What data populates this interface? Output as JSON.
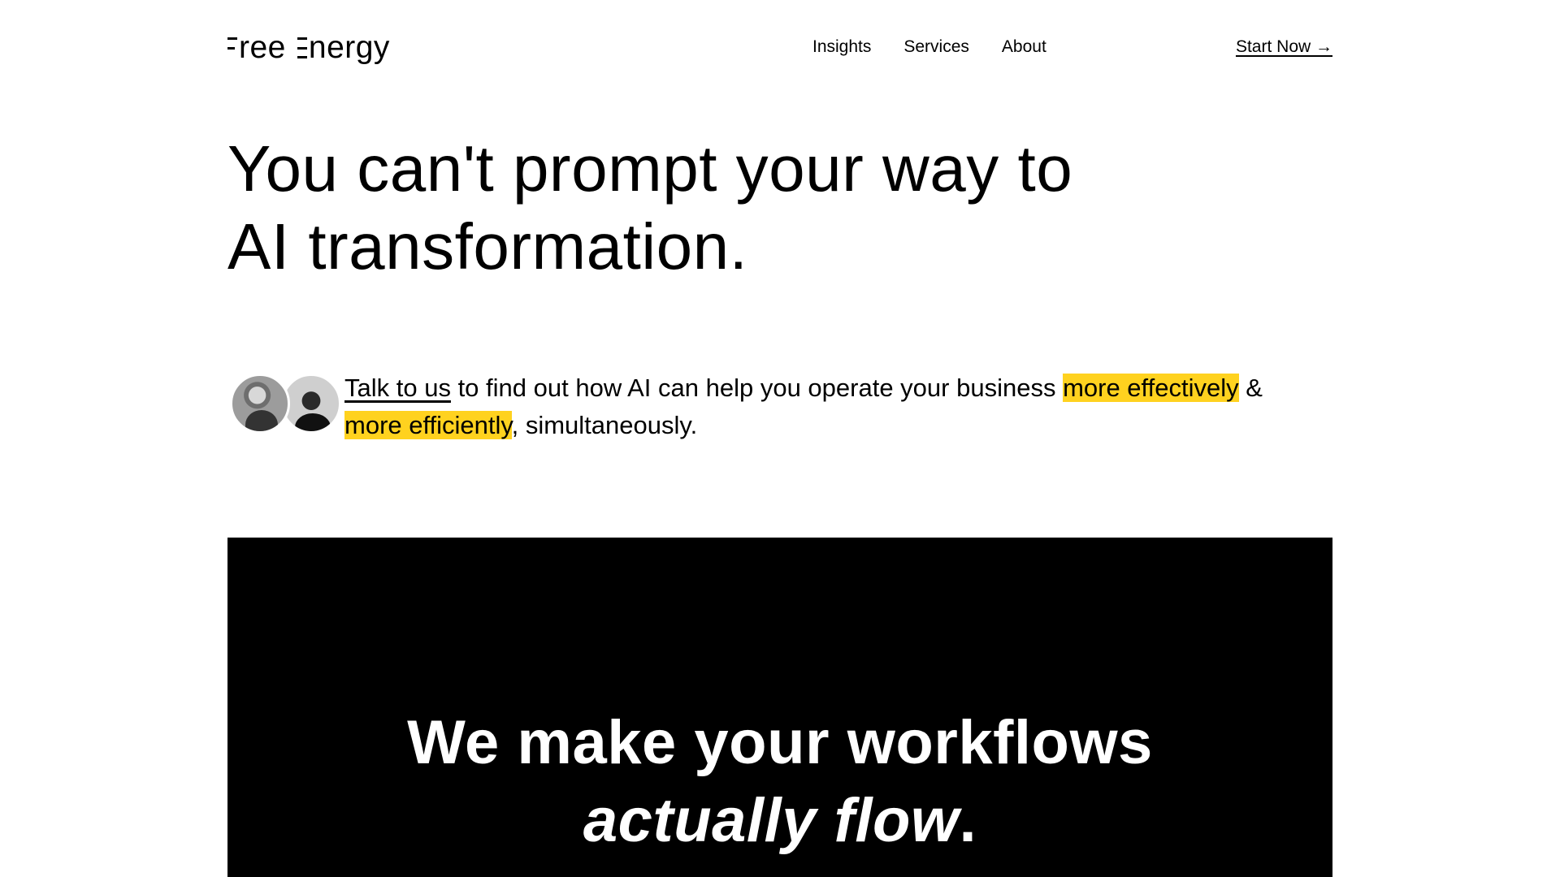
{
  "header": {
    "logo_word1": "ree",
    "logo_word2": "nergy",
    "logo_full": "Free Energy",
    "nav": [
      {
        "label": "Insights"
      },
      {
        "label": "Services"
      },
      {
        "label": "About"
      }
    ],
    "cta_label": "Start Now →"
  },
  "hero": {
    "title_line1": "You can't prompt your way to",
    "title_line2": "AI transformation."
  },
  "intro": {
    "link_text": "Talk to us",
    "text_mid": " to find out how AI can help you operate your business ",
    "highlight1": "more effectively",
    "text_amp": " & ",
    "highlight2": "more efficiently",
    "text_end": ", simultaneously."
  },
  "band": {
    "title_line1": "We make your workflows",
    "title_line2_italic": "actually flow",
    "title_line2_end": "."
  },
  "colors": {
    "highlight": "#ffd21f",
    "band_bg": "#000000",
    "text": "#000000"
  }
}
